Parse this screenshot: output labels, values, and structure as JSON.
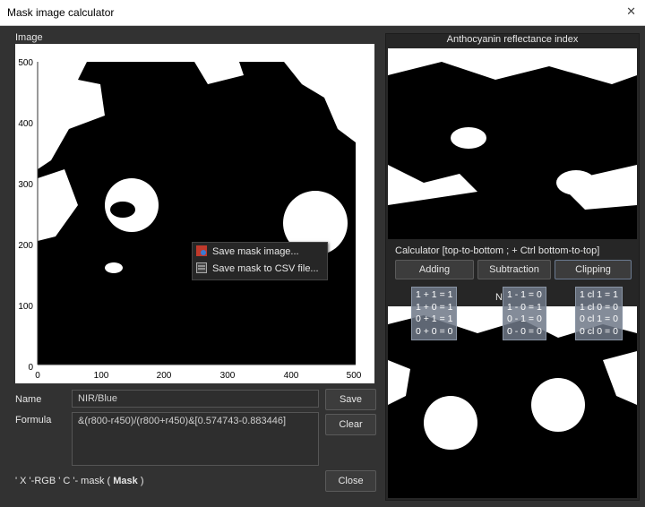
{
  "window": {
    "title": "Mask image calculator",
    "close_symbol": "✕"
  },
  "image_panel": {
    "label": "Image",
    "y_ticks": [
      "500",
      "400",
      "300",
      "200",
      "100",
      "0"
    ],
    "x_ticks": [
      "0",
      "100",
      "200",
      "300",
      "400",
      "500"
    ]
  },
  "context_menu": {
    "items": [
      {
        "label": "Save mask image...",
        "icon": "save-image-icon"
      },
      {
        "label": "Save mask to CSV file...",
        "icon": "csv-file-icon"
      }
    ]
  },
  "form": {
    "name_label": "Name",
    "name_value": "NIR/Blue",
    "formula_label": "Formula",
    "formula_value": "&(r800-r450)/(r800+r450)&[0.574743-0.883446]",
    "hint_text": "' X '-RGB ' C '- mask ( ",
    "hint_bold": "Mask",
    "hint_end": " )",
    "save_label": "Save",
    "clear_label": "Clear",
    "close_label": "Close"
  },
  "right_panel": {
    "title": "Anthocyanin reflectance index",
    "calculator_label": "Calculator [top-to-bottom ; + Ctrl bottom-to-top]",
    "buttons": [
      "Adding",
      "Subtraction",
      "Clipping"
    ],
    "partial_label": "N",
    "tooltips": {
      "adding": "1 + 1 = 1\n1 + 0 = 1\n0 + 1 = 1\n0 + 0 = 0",
      "subtraction": "1 - 1 = 0\n1 - 0 = 1\n0 - 1 = 0\n0 - 0 = 0",
      "clipping": "1 cl 1 = 1\n1 cl 0 = 0\n0 cl 1 = 0\n0 cl 0 = 0"
    }
  },
  "colors": {
    "background": "#323232",
    "panel": "#262626",
    "accent": "#e6e6e6"
  }
}
